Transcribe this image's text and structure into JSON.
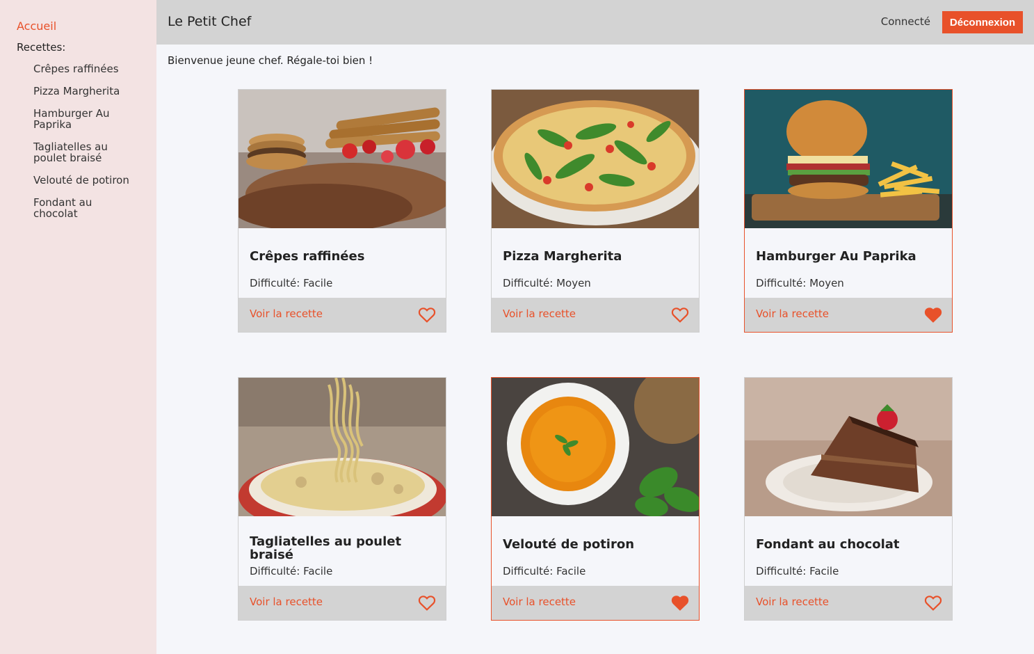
{
  "header": {
    "title": "Le Petit Chef",
    "status": "Connecté",
    "logout_label": "Déconnexion"
  },
  "sidebar": {
    "home_label": "Accueil",
    "recipes_heading": "Recettes:",
    "items": [
      "Crêpes raffinées",
      "Pizza Margherita",
      "Hamburger Au Paprika",
      "Tagliatelles au poulet braisé",
      "Velouté de potiron",
      "Fondant au chocolat"
    ]
  },
  "main": {
    "welcome": "Bienvenue jeune chef. Régale-toi bien !",
    "cards": [
      {
        "title": "Crêpes raffinées",
        "difficulty": "Difficulté: Facile",
        "link_label": "Voir la recette",
        "favorite": false,
        "image": "crepes-photo"
      },
      {
        "title": "Pizza Margherita",
        "difficulty": "Difficulté: Moyen",
        "link_label": "Voir la recette",
        "favorite": false,
        "image": "pizza-photo"
      },
      {
        "title": "Hamburger Au Paprika",
        "difficulty": "Difficulté: Moyen",
        "link_label": "Voir la recette",
        "favorite": true,
        "image": "hamburger-photo"
      },
      {
        "title": "Tagliatelles au poulet braisé",
        "difficulty": "Difficulté: Facile",
        "link_label": "Voir la recette",
        "favorite": false,
        "image": "tagliatelles-photo"
      },
      {
        "title": "Velouté de potiron",
        "difficulty": "Difficulté: Facile",
        "link_label": "Voir la recette",
        "favorite": true,
        "image": "soup-photo"
      },
      {
        "title": "Fondant au chocolat",
        "difficulty": "Difficulté: Facile",
        "link_label": "Voir la recette",
        "favorite": false,
        "image": "chocolate-cake-photo"
      }
    ]
  },
  "colors": {
    "accent": "#e8512a",
    "header_bg": "#d3d3d3",
    "sidebar_bg": "#f3e3e3",
    "page_bg": "#f5f6fa"
  },
  "icons": {
    "favorite_on": "heart-filled-icon",
    "favorite_off": "heart-outline-icon"
  }
}
